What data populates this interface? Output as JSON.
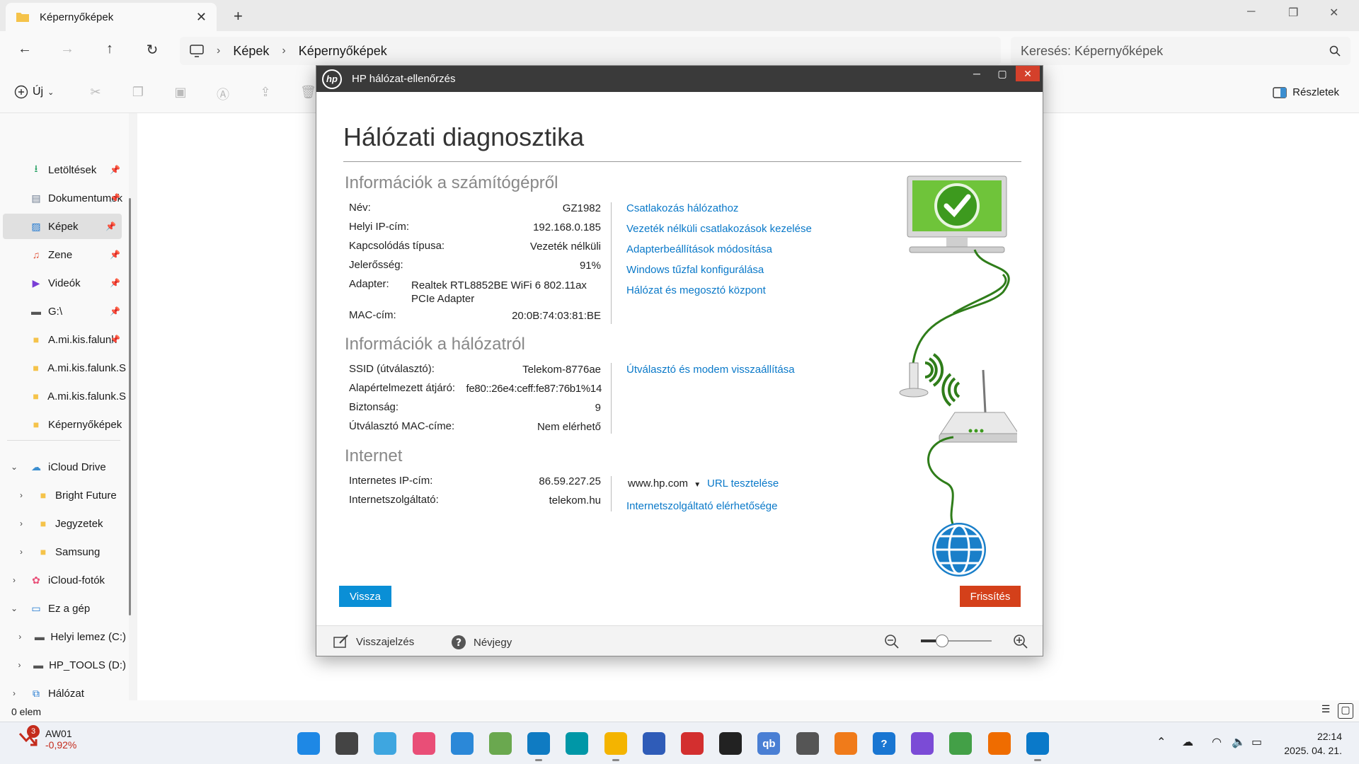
{
  "explorer": {
    "tab_title": "Képernyőképek",
    "new_tab": "+",
    "win_min": "─",
    "win_max": "❐",
    "win_close": "✕",
    "breadcrumb": [
      "Képek",
      "Képernyőképek"
    ],
    "search_placeholder": "Keresés: Képernyőképek",
    "new_label": "Új",
    "details_label": "Részletek",
    "status": "0 elem",
    "sidebar_quick": [
      {
        "label": "Letöltések",
        "icon": "download-icon"
      },
      {
        "label": "Dokumentumok",
        "icon": "document-icon"
      },
      {
        "label": "Képek",
        "icon": "pictures-icon"
      },
      {
        "label": "Zene",
        "icon": "music-icon"
      },
      {
        "label": "Videók",
        "icon": "video-icon"
      },
      {
        "label": "G:\\",
        "icon": "drive-icon"
      },
      {
        "label": "A.mi.kis.falunk",
        "icon": "folder-icon"
      },
      {
        "label": "A.mi.kis.falunk.S",
        "icon": "folder-icon"
      },
      {
        "label": "A.mi.kis.falunk.S",
        "icon": "folder-icon"
      },
      {
        "label": "Képernyőképek",
        "icon": "folder-icon"
      }
    ],
    "sidebar_tree": [
      {
        "label": "iCloud Drive",
        "icon": "cloud-icon"
      },
      {
        "label": "Bright Future",
        "icon": "folder-icon"
      },
      {
        "label": "Jegyzetek",
        "icon": "folder-icon"
      },
      {
        "label": "Samsung",
        "icon": "folder-icon"
      },
      {
        "label": "iCloud-fotók",
        "icon": "photos-icon"
      },
      {
        "label": "Ez a gép",
        "icon": "pc-icon"
      },
      {
        "label": "Helyi lemez (C:)",
        "icon": "disk-icon"
      },
      {
        "label": "HP_TOOLS (D:)",
        "icon": "disk-icon"
      },
      {
        "label": "Hálózat",
        "icon": "network-icon"
      }
    ]
  },
  "hp": {
    "window_title": "HP hálózat-ellenőrzés",
    "logo": "hp",
    "heading": "Hálózati diagnosztika",
    "computer_section": "Információk a számítógépről",
    "computer": [
      {
        "label": "Név:",
        "value": "GZ1982"
      },
      {
        "label": "Helyi IP-cím:",
        "value": "192.168.0.185"
      },
      {
        "label": "Kapcsolódás típusa:",
        "value": "Vezeték nélküli"
      },
      {
        "label": "Jelerősség:",
        "value": "91%"
      },
      {
        "label": "Adapter:",
        "value": "Realtek RTL8852BE WiFi 6 802.11ax PCIe Adapter"
      },
      {
        "label": "MAC-cím:",
        "value": "20:0B:74:03:81:BE"
      }
    ],
    "computer_links": [
      "Csatlakozás hálózathoz",
      "Vezeték nélküli csatlakozások kezelése",
      "Adapterbeállítások módosítása",
      "Windows tűzfal konfigurálása",
      "Hálózat és megosztó központ"
    ],
    "network_section": "Információk a hálózatról",
    "network": [
      {
        "label": "SSID (útválasztó):",
        "value": "Telekom-8776ae"
      },
      {
        "label": "Alapértelmezett átjáró:",
        "value": "fe80::26e4:ceff:fe87:76b1%14"
      },
      {
        "label": "Biztonság:",
        "value": "9"
      },
      {
        "label": "Útválasztó MAC-címe:",
        "value": "Nem elérhető"
      }
    ],
    "network_link": "Útválasztó és modem visszaállítása",
    "internet_section": "Internet",
    "internet": [
      {
        "label": "Internetes IP-cím:",
        "value": "86.59.227.25"
      },
      {
        "label": "Internetszolgáltató:",
        "value": "telekom.hu"
      }
    ],
    "url_select": "www.hp.com",
    "url_test_link": "URL tesztelése",
    "isp_link": "Internetszolgáltató elérhetősége",
    "back_button": "Vissza",
    "refresh_button": "Frissítés",
    "feedback": "Visszajelzés",
    "about": "Névjegy",
    "zoom_level": 0.3
  },
  "taskbar": {
    "stock_name": "AW01",
    "stock_change": "-0,92%",
    "stock_badge": "3",
    "apps": [
      {
        "name": "start-icon",
        "glyph": "",
        "bg": "#1e88e5"
      },
      {
        "name": "task-view-icon",
        "glyph": "",
        "bg": "#444444"
      },
      {
        "name": "weather-icon",
        "glyph": "",
        "bg": "#3ea6e0"
      },
      {
        "name": "photos-app-icon",
        "glyph": "",
        "bg": "#e94e77"
      },
      {
        "name": "onedrive-icon",
        "glyph": "",
        "bg": "#2b88d8"
      },
      {
        "name": "keepass-icon",
        "glyph": "",
        "bg": "#6aa84f"
      },
      {
        "name": "edge-icon",
        "glyph": "",
        "bg": "#0f7bc2"
      },
      {
        "name": "app-sketch-icon",
        "glyph": "",
        "bg": "#0097a7"
      },
      {
        "name": "file-explorer-icon",
        "glyph": "",
        "bg": "#f4b400"
      },
      {
        "name": "store-icon",
        "glyph": "",
        "bg": "#2f5cb8"
      },
      {
        "name": "amd-icon",
        "glyph": "",
        "bg": "#d32f2f"
      },
      {
        "name": "audio-app-icon",
        "glyph": "",
        "bg": "#222222"
      },
      {
        "name": "qbittorrent-icon",
        "glyph": "qb",
        "bg": "#4a7fd4"
      },
      {
        "name": "calculator-icon",
        "glyph": "",
        "bg": "#555555"
      },
      {
        "name": "loyalty-club-icon",
        "glyph": "",
        "bg": "#f07b1a"
      },
      {
        "name": "help-icon",
        "glyph": "?",
        "bg": "#1976d2"
      },
      {
        "name": "copilot-icon",
        "glyph": "",
        "bg": "#7b4bd6"
      },
      {
        "name": "stocks-icon",
        "glyph": "",
        "bg": "#43a047"
      },
      {
        "name": "vlc-icon",
        "glyph": "",
        "bg": "#ef6c00"
      },
      {
        "name": "hp-network-icon",
        "glyph": "",
        "bg": "#0a79c9"
      }
    ],
    "time": "22:14",
    "date": "2025. 04. 21."
  }
}
